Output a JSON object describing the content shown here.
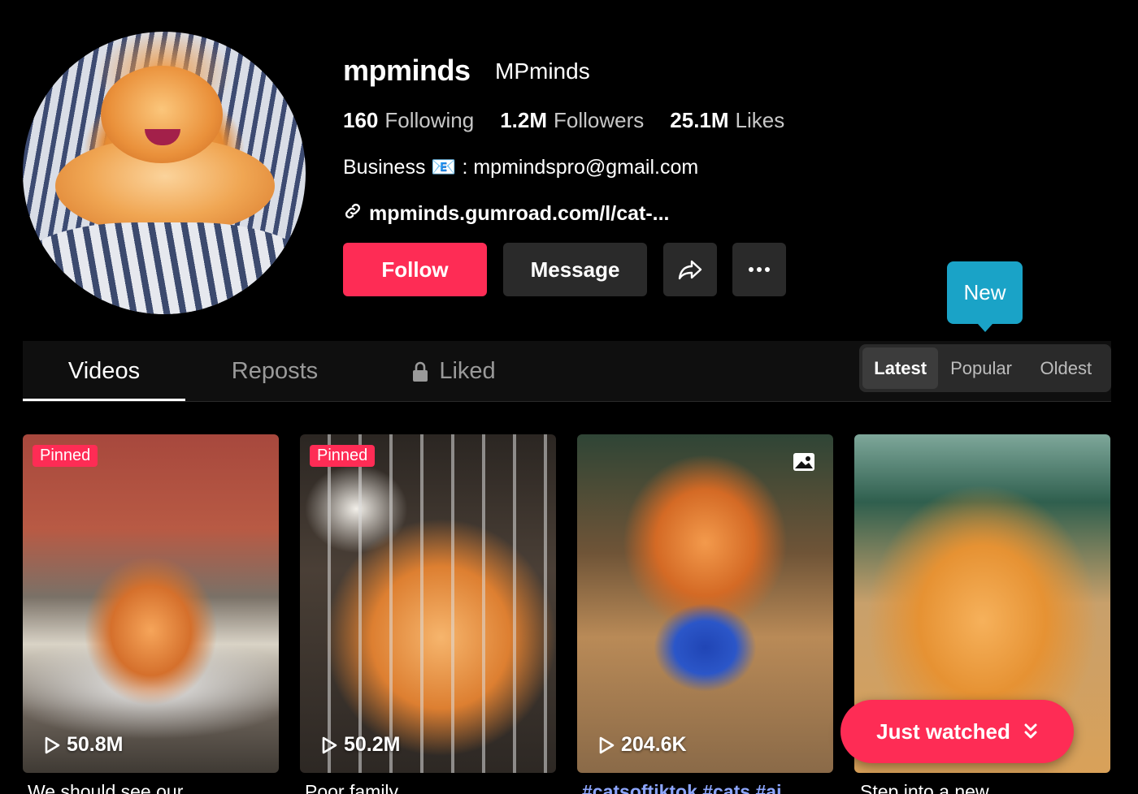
{
  "profile": {
    "username": "mpminds",
    "nickname": "MPminds",
    "stats": {
      "following_count": "160",
      "following_label": "Following",
      "followers_count": "1.2M",
      "followers_label": "Followers",
      "likes_count": "25.1M",
      "likes_label": "Likes"
    },
    "bio": "Business 📧 : mpmindspro@gmail.com",
    "link": "mpminds.gumroad.com/l/cat-..."
  },
  "actions": {
    "follow_label": "Follow",
    "message_label": "Message",
    "share_icon": "share-icon",
    "more_icon": "more-icon"
  },
  "tooltip": {
    "new_label": "New"
  },
  "tabs": [
    {
      "label": "Videos",
      "active": true
    },
    {
      "label": "Reposts",
      "active": false
    },
    {
      "label": "Liked",
      "active": false,
      "icon": "lock-icon"
    }
  ],
  "sort": {
    "options": [
      {
        "label": "Latest",
        "active": true
      },
      {
        "label": "Popular",
        "active": false
      },
      {
        "label": "Oldest",
        "active": false
      }
    ]
  },
  "videos": [
    {
      "badge": "Pinned",
      "views": "50.8M",
      "caption": "We should see our"
    },
    {
      "badge": "Pinned",
      "views": "50.2M",
      "caption": "Poor family"
    },
    {
      "badge": "",
      "views": "204.6K",
      "caption": "#catsoftiktok #cats #ai",
      "icon": "photo-icon"
    },
    {
      "badge": "",
      "views": "",
      "caption": "Step into a new"
    }
  ],
  "just_watched": {
    "label": "Just watched"
  },
  "colors": {
    "accent": "#fe2c55",
    "tooltip": "#1aa3c7",
    "surface": "#2a2a2a"
  }
}
